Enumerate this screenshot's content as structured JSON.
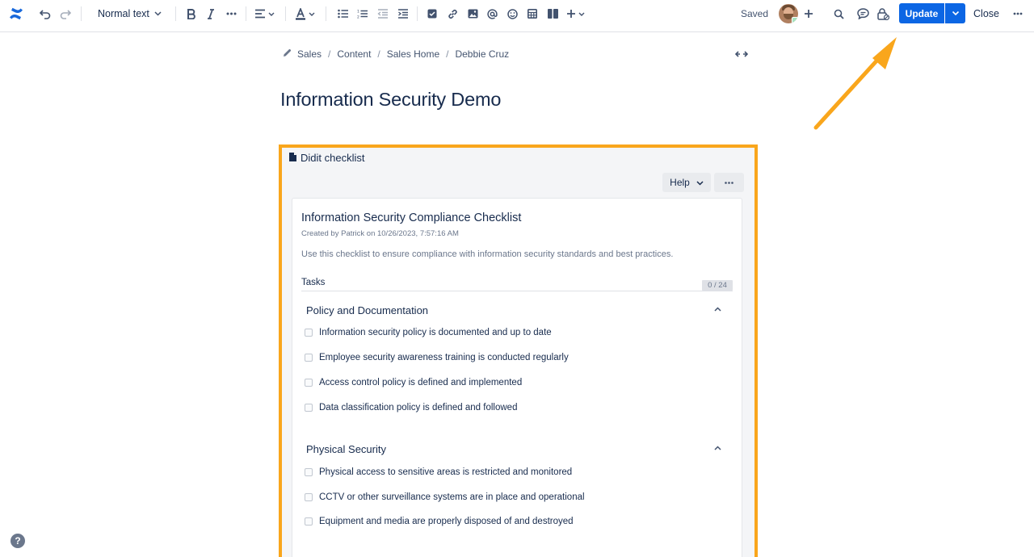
{
  "toolbar": {
    "text_style": "Normal text",
    "saved_label": "Saved",
    "update_label": "Update",
    "close_label": "Close"
  },
  "breadcrumb": [
    "Sales",
    "Content",
    "Sales Home",
    "Debbie Cruz"
  ],
  "page_title": "Information Security Demo",
  "macro": {
    "name": "Didit checklist",
    "help_label": "Help",
    "checklist": {
      "title": "Information Security Compliance Checklist",
      "created": "Created by Patrick on 10/26/2023, 7:57:16 AM",
      "description": "Use this checklist to ensure compliance with information security standards and best practices.",
      "tasks_label": "Tasks",
      "progress": "0 / 24",
      "sections": [
        {
          "title": "Policy and Documentation",
          "items": [
            "Information security policy is documented and up to date",
            "Employee security awareness training is conducted regularly",
            "Access control policy is defined and implemented",
            "Data classification policy is defined and followed"
          ]
        },
        {
          "title": "Physical Security",
          "items": [
            "Physical access to sensitive areas is restricted and monitored",
            "CCTV or other surveillance systems are in place and operational",
            "Equipment and media are properly disposed of and destroyed"
          ]
        }
      ]
    }
  },
  "colors": {
    "accent": "#0c66e4",
    "highlight": "#f9a61c",
    "text": "#172b4d"
  }
}
